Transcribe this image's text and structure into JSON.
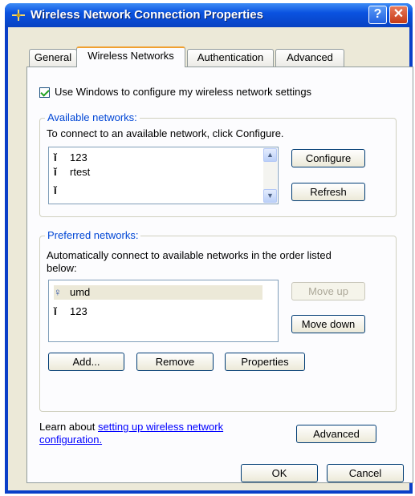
{
  "window": {
    "title": "Wireless Network Connection Properties"
  },
  "titlebar": {
    "help_label": "?",
    "close_label": "✕"
  },
  "tabs": [
    {
      "label": "General"
    },
    {
      "label": "Wireless Networks"
    },
    {
      "label": "Authentication"
    },
    {
      "label": "Advanced"
    }
  ],
  "use_windows": {
    "label": "Use Windows to configure my wireless network settings",
    "checked": true
  },
  "available": {
    "title": "Available networks:",
    "description": "To connect to an available network, click Configure.",
    "networks": [
      {
        "name": "123",
        "icon": "antenna-icon"
      },
      {
        "name": "rtest",
        "icon": "antenna-icon"
      },
      {
        "name": "",
        "icon": "antenna-icon"
      }
    ],
    "configure_label": "Configure",
    "refresh_label": "Refresh"
  },
  "preferred": {
    "title": "Preferred networks:",
    "description_line1": "Automatically connect to available networks in the order listed",
    "description_line2": "below:",
    "networks": [
      {
        "name": "umd",
        "icon": "connected-antenna-icon",
        "selected": true
      },
      {
        "name": "123",
        "icon": "antenna-icon",
        "selected": false
      }
    ],
    "move_up_label": "Move up",
    "move_down_label": "Move down",
    "add_label": "Add...",
    "remove_label": "Remove",
    "properties_label": "Properties"
  },
  "learn": {
    "prefix": "Learn about ",
    "link_line1": "setting up wireless network",
    "link_line2": "configuration."
  },
  "advanced_label": "Advanced",
  "footer": {
    "ok_label": "OK",
    "cancel_label": "Cancel"
  },
  "colors": {
    "titlebar": "#0a52e0",
    "dialog_bg": "#ece9d8",
    "group_title": "#0046d5",
    "link": "#0000ff"
  }
}
